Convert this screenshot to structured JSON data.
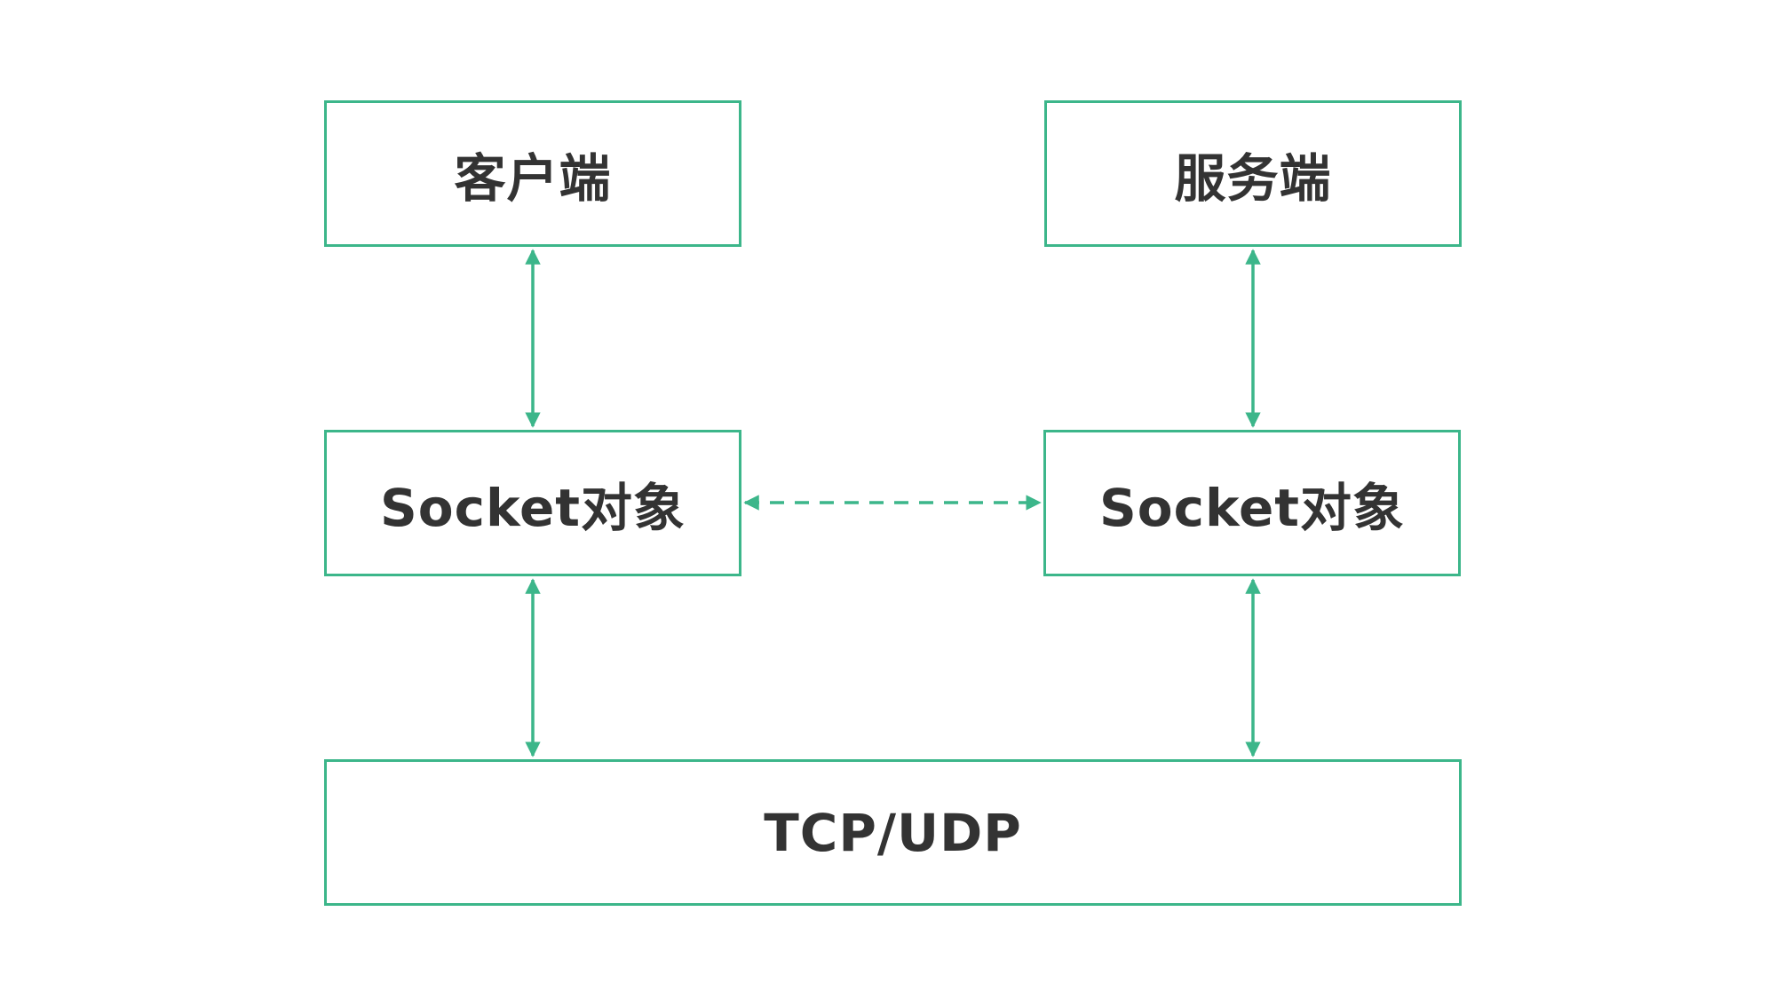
{
  "colors": {
    "stroke": "#3cb68a",
    "text": "#333333",
    "background": "#ffffff"
  },
  "nodes": {
    "client": {
      "label": "客户端"
    },
    "server": {
      "label": "服务端"
    },
    "socket_client": {
      "label": "Socket对象"
    },
    "socket_server": {
      "label": "Socket对象"
    },
    "transport": {
      "label": "TCP/UDP"
    }
  },
  "edges": [
    {
      "from": "client",
      "to": "socket_client",
      "style": "solid",
      "direction": "both"
    },
    {
      "from": "server",
      "to": "socket_server",
      "style": "solid",
      "direction": "both"
    },
    {
      "from": "socket_client",
      "to": "socket_server",
      "style": "dashed",
      "direction": "both"
    },
    {
      "from": "socket_client",
      "to": "transport",
      "style": "solid",
      "direction": "both"
    },
    {
      "from": "socket_server",
      "to": "transport",
      "style": "solid",
      "direction": "both"
    }
  ]
}
